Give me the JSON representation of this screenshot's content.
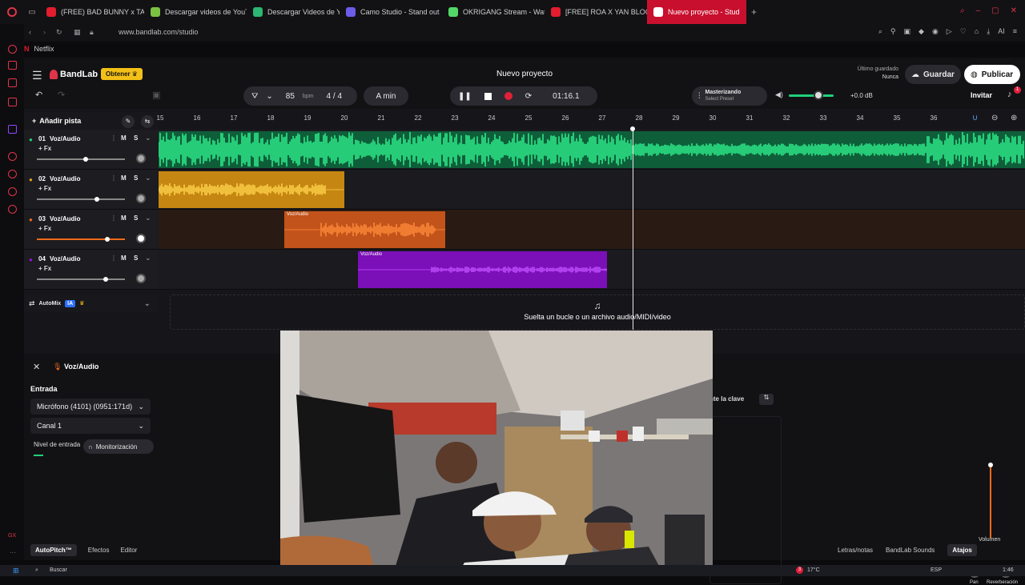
{
  "browser": {
    "tabs": [
      {
        "label": "(FREE) BAD BUNNY x TAI",
        "color": "#e11d2e"
      },
      {
        "label": "Descargar videos de YouT",
        "color": "#7cc242"
      },
      {
        "label": "Descargar Videos de You",
        "color": "#2bb673"
      },
      {
        "label": "Camo Studio - Stand out",
        "color": "#6c5ce7"
      },
      {
        "label": "OKRIGANG Stream - Wat",
        "color": "#53d769"
      },
      {
        "label": "[FREE] ROA X YAN BLOCK",
        "color": "#e11d2e"
      },
      {
        "label": "Nuevo proyecto - Stud",
        "color": "#ffffff"
      }
    ],
    "url": "www.bandlab.com/studio",
    "bookmark": "Netflix"
  },
  "app": {
    "brand": "BandLab",
    "obtain_label": "Obtener",
    "project_title": "Nuevo proyecto",
    "last_saved_label": "Último guardado",
    "last_saved_value": "Nunca",
    "save_label": "Guardar",
    "publish_label": "Publicar",
    "invite_label": "Invitar",
    "notif_count": "1",
    "bpm": "85",
    "bpm_unit": "bpm",
    "time_sig": "4 / 4",
    "key": "A min",
    "time": "01:16.1",
    "mastering_title": "Masterizando",
    "mastering_sub": "Select Preset",
    "master_db": "+0.0 dB",
    "add_track_label": "Añadir pista",
    "ruler": [
      "15",
      "16",
      "17",
      "18",
      "19",
      "20",
      "21",
      "22",
      "23",
      "24",
      "25",
      "26",
      "27",
      "28",
      "29",
      "30",
      "31",
      "32",
      "33",
      "34",
      "35",
      "36"
    ],
    "tracks": [
      {
        "num": "01",
        "name": "Voz/Audio",
        "fx": "+ Fx",
        "m": "M",
        "s": "S",
        "color": "#20d07a",
        "vol": 0.55
      },
      {
        "num": "02",
        "name": "Voz/Audio",
        "fx": "+ Fx",
        "m": "M",
        "s": "S",
        "color": "#e0a020",
        "vol": 0.68
      },
      {
        "num": "03",
        "name": "Voz/Audio",
        "fx": "+ Fx",
        "m": "M",
        "s": "S",
        "color": "#f06a1a",
        "vol": 0.8
      },
      {
        "num": "04",
        "name": "Voz/Audio",
        "fx": "+ Fx",
        "m": "M",
        "s": "S",
        "color": "#9a10e0",
        "vol": 0.78
      }
    ],
    "clip_label": "Voz/Audio",
    "automix_label": "AutoMix",
    "ai_badge": "IA",
    "drop_text": "Suelta un bucle o un archivo audio/MIDI/video",
    "lower": {
      "panel_title": "Voz/Audio",
      "input_label": "Entrada",
      "input_device": "Micrófono (4101) (0951:171d)",
      "channel": "Canal 1",
      "input_level_label": "Nivel de entrada",
      "monitor_label": "Monitorización",
      "key_label": "nte la clave",
      "volume_label": "Volumen",
      "pan_label": "Pan",
      "reverb_label": "Reverberación",
      "bottom_tabs": [
        "AutoPitch™",
        "Efectos",
        "Editor"
      ],
      "right_tabs": [
        "Letras/notas",
        "BandLab Sounds",
        "Atajos"
      ]
    }
  },
  "taskbar": {
    "search": "Buscar",
    "temp": "17°C",
    "temp_badge": "3",
    "lang": "ESP",
    "time": "1:46"
  },
  "colors": {
    "accent": "#e0344b",
    "green": "#20d07a",
    "orange": "#f06a1a",
    "gold": "#e0a020",
    "purple": "#9a10e0"
  }
}
